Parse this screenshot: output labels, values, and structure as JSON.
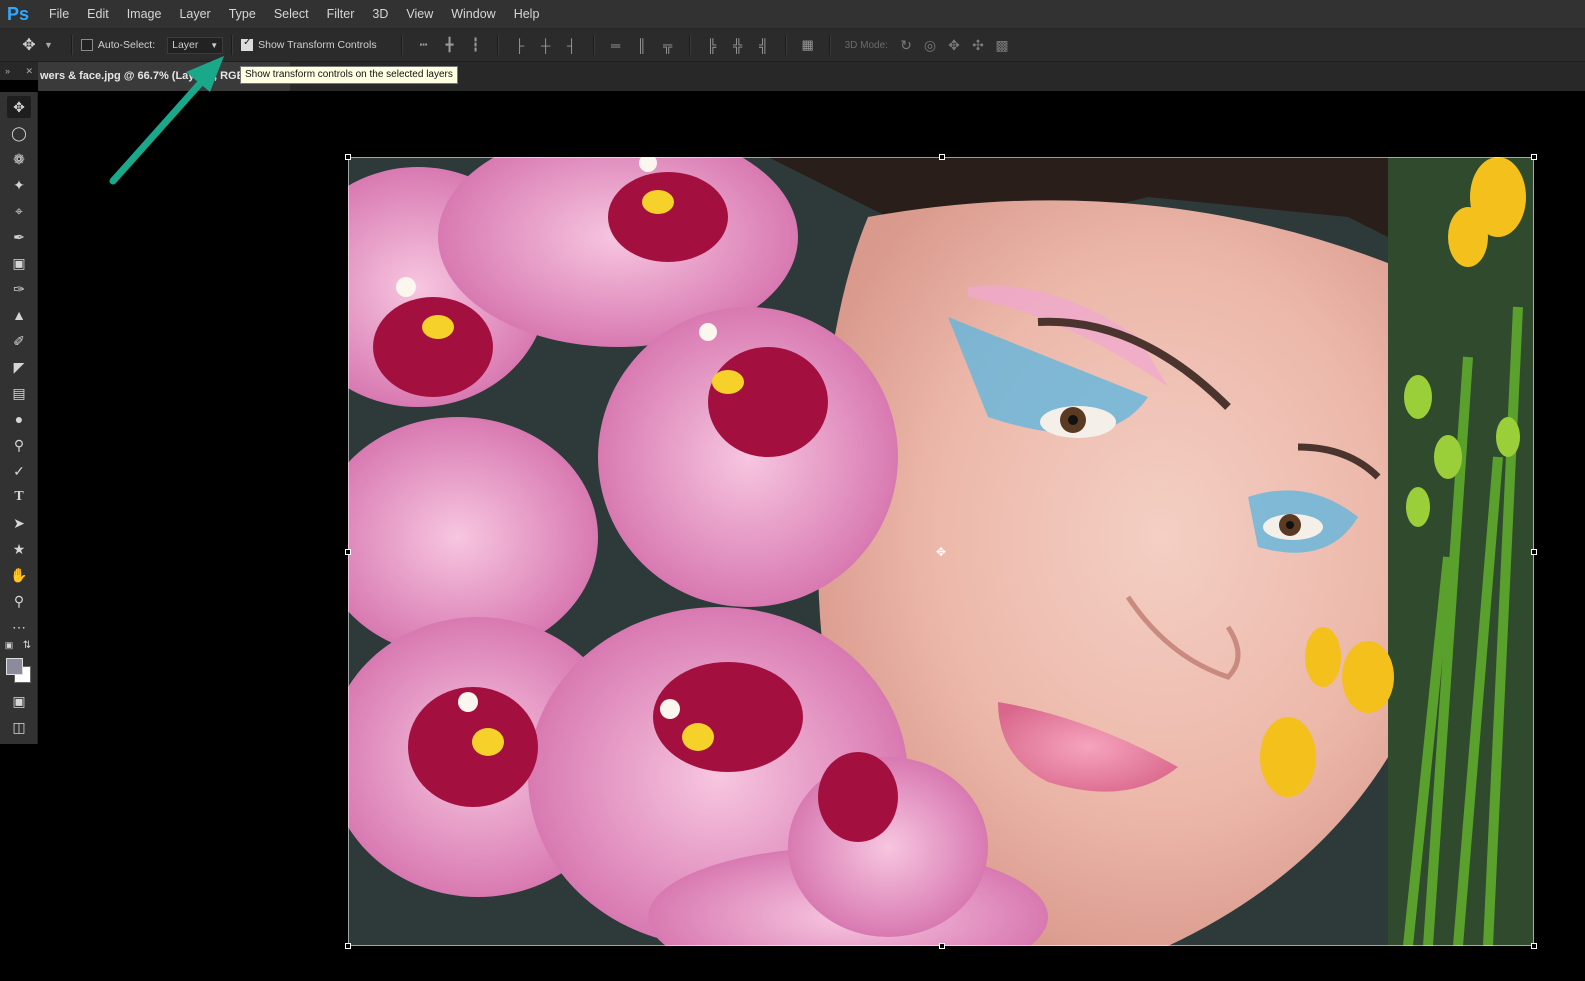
{
  "app": {
    "logo": "Ps"
  },
  "menu": [
    "File",
    "Edit",
    "Image",
    "Layer",
    "Type",
    "Select",
    "Filter",
    "3D",
    "View",
    "Window",
    "Help"
  ],
  "options": {
    "auto_select_label": "Auto-Select:",
    "auto_select_checked": false,
    "layer_dropdown": "Layer",
    "show_transform_label": "Show Transform Controls",
    "show_transform_checked": true,
    "mode_3d_label": "3D Mode:"
  },
  "tooltip": "Show transform controls on the selected layers",
  "document": {
    "tab_title": "wers & face.jpg @ 66.7% (Layer 0, RGB/8)"
  },
  "tools": [
    "move-tool",
    "marquee-tool",
    "lasso-tool",
    "magic-wand-tool",
    "crop-tool",
    "eyedropper-tool",
    "spot-healing-tool",
    "brush-tool",
    "clone-stamp-tool",
    "history-brush-tool",
    "eraser-tool",
    "gradient-tool",
    "blur-tool",
    "dodge-tool",
    "pen-tool",
    "type-tool",
    "path-selection-tool",
    "shape-tool",
    "hand-tool",
    "zoom-tool",
    "more-tools"
  ],
  "colors": {
    "foreground": "#8b8b9c",
    "background": "#ffffff",
    "annotation_arrow": "#1aa88a",
    "accent": "#31a8ff"
  }
}
